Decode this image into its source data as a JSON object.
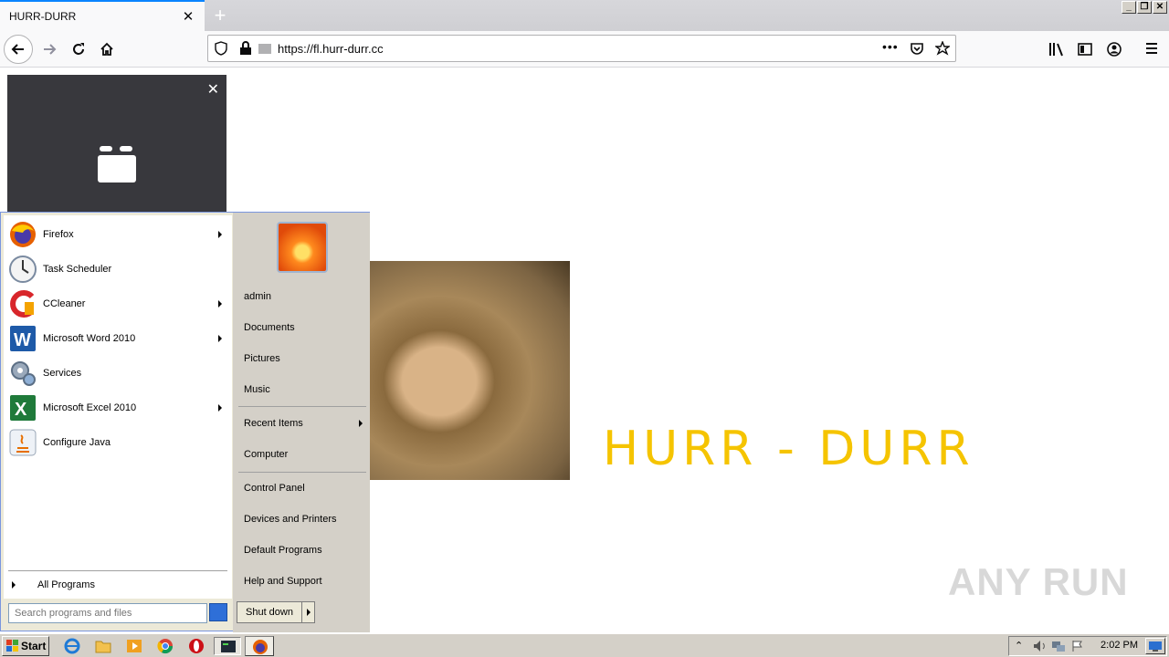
{
  "browser": {
    "tab_title": "HURR-DURR",
    "url": "https://fl.hurr-durr.cc"
  },
  "page": {
    "heading": "HURR - DURR",
    "watermark": "ANY RUN"
  },
  "start_menu": {
    "programs": [
      {
        "label": "Firefox",
        "icon": "firefox-icon",
        "has_submenu": true
      },
      {
        "label": "Task Scheduler",
        "icon": "clock-icon",
        "has_submenu": false
      },
      {
        "label": "CCleaner",
        "icon": "ccleaner-icon",
        "has_submenu": true
      },
      {
        "label": "Microsoft Word 2010",
        "icon": "word-icon",
        "has_submenu": true
      },
      {
        "label": "Services",
        "icon": "gears-icon",
        "has_submenu": false
      },
      {
        "label": "Microsoft Excel 2010",
        "icon": "excel-icon",
        "has_submenu": true
      },
      {
        "label": "Configure Java",
        "icon": "java-icon",
        "has_submenu": false
      }
    ],
    "all_programs": "All Programs",
    "search_placeholder": "Search programs and files",
    "right_items": [
      "admin",
      "Documents",
      "Pictures",
      "Music",
      "Recent Items",
      "Computer",
      "Control Panel",
      "Devices and Printers",
      "Default Programs",
      "Help and Support"
    ],
    "shutdown_label": "Shut down"
  },
  "taskbar": {
    "start_label": "Start",
    "clock": "2:02 PM"
  },
  "colors": {
    "heading": "#f5c400",
    "tab_accent": "#0a84ff"
  }
}
